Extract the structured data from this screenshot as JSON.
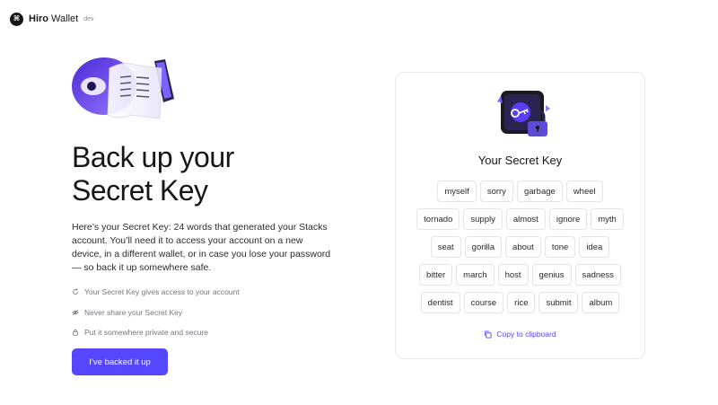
{
  "brand": {
    "name_bold": "Hiro",
    "name_light": " Wallet",
    "env": "dev",
    "logo_glyph": "⌘"
  },
  "main": {
    "title_line1": "Back up your",
    "title_line2": "Secret Key",
    "description": "Here’s your Secret Key: 24 words that generated your Stacks account. You’ll need it to access your account on a new device, in a different wallet, or in case you lose your password — so back it up somewhere safe.",
    "tips": [
      {
        "icon": "refresh-icon",
        "text": "Your Secret Key gives access to your account"
      },
      {
        "icon": "eye-off-icon",
        "text": "Never share your Secret Key"
      },
      {
        "icon": "lock-icon",
        "text": "Put it somewhere private and secure"
      }
    ],
    "cta_label": "I’ve backed it up"
  },
  "card": {
    "title": "Your Secret Key",
    "words": [
      [
        "myself",
        "sorry",
        "garbage",
        "wheel"
      ],
      [
        "tornado",
        "supply",
        "almost",
        "ignore",
        "myth"
      ],
      [
        "seat",
        "gorilla",
        "about",
        "tone",
        "idea"
      ],
      [
        "bitter",
        "march",
        "host",
        "genius",
        "sadness"
      ],
      [
        "dentist",
        "course",
        "rice",
        "submit",
        "album"
      ]
    ],
    "copy_label": "Copy to clipboard"
  },
  "colors": {
    "accent": "#5546ff",
    "text": "#17171a",
    "muted": "#74777d",
    "border": "#e4e4e9"
  }
}
